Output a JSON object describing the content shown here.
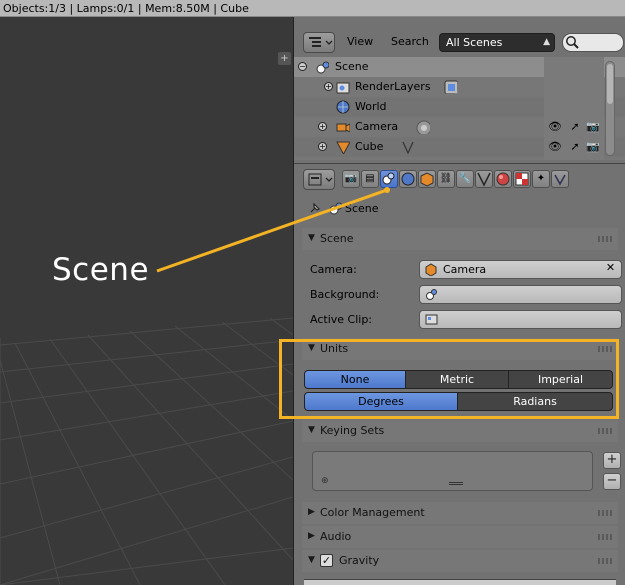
{
  "statusbar": {
    "text": "Objects:1/3 | Lamps:0/1 | Mem:8.50M | Cube"
  },
  "viewport": {
    "corner_icon": "plus-icon"
  },
  "outliner": {
    "menu": [
      "View",
      "Search"
    ],
    "scene_select": "All Scenes",
    "rows": [
      {
        "label": "Scene",
        "icon": "scene-icon"
      },
      {
        "label": "RenderLayers",
        "icon": "render-layers-icon"
      },
      {
        "label": "World",
        "icon": "world-icon"
      },
      {
        "label": "Camera",
        "icon": "camera-icon"
      },
      {
        "label": "Cube",
        "icon": "mesh-icon"
      }
    ]
  },
  "properties": {
    "breadcrumb": "Scene",
    "scene_panel": {
      "title": "Scene",
      "camera_label": "Camera:",
      "camera_value": "Camera",
      "background_label": "Background:",
      "active_clip_label": "Active Clip:"
    },
    "units_panel": {
      "title": "Units",
      "systems": [
        "None",
        "Metric",
        "Imperial"
      ],
      "rotation": [
        "Degrees",
        "Radians"
      ]
    },
    "keying_panel": {
      "title": "Keying Sets",
      "add": "+",
      "remove": "−"
    },
    "color_panel": {
      "title": "Color Management"
    },
    "audio_panel": {
      "title": "Audio"
    },
    "gravity_panel": {
      "title": "Gravity"
    }
  },
  "annotation": {
    "label": "Scene",
    "color": "#f4b324"
  },
  "colors": {
    "accent_blue": "#5a84d4",
    "highlight": "#f4b324"
  }
}
